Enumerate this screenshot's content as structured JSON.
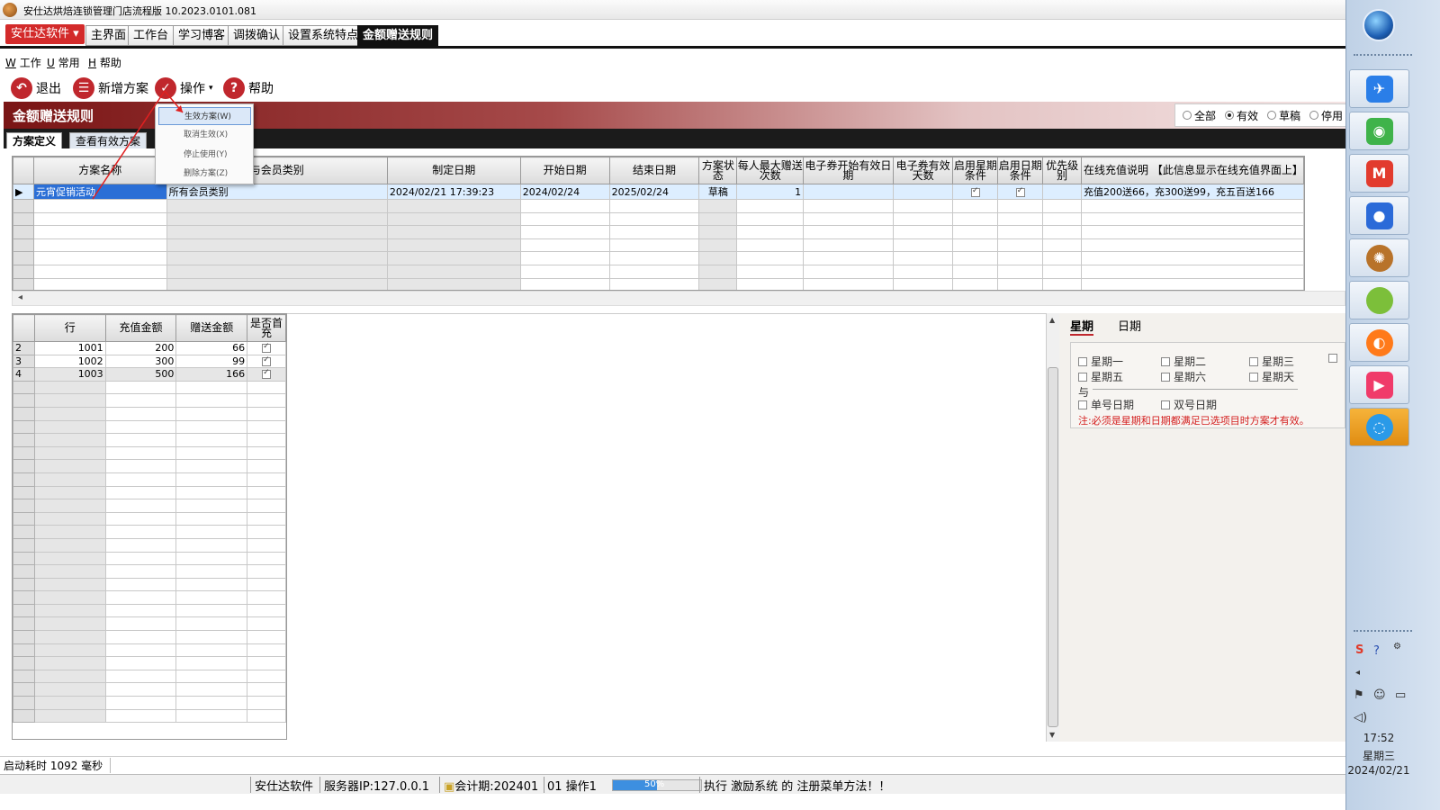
{
  "window": {
    "title": "安仕达烘焙连锁管理门店流程版   10.2023.0101.081"
  },
  "brand_button": "安仕达软件",
  "main_tabs": [
    "主界面",
    "工作台",
    "学习博客",
    "调拨确认",
    "设置系统特点",
    "金额赠送规则"
  ],
  "menubar": {
    "work": "工作",
    "common": "常用",
    "help": "帮助",
    "work_key": "W",
    "common_key": "U",
    "help_key": "H"
  },
  "toolbar": {
    "exit": "退出",
    "new_plan": "新增方案",
    "operate": "操作",
    "help": "帮助"
  },
  "dropdown": {
    "items": [
      "生效方案(W)",
      "取消生效(X)",
      "停止使用(Y)",
      "删除方案(Z)"
    ]
  },
  "banner": {
    "title": "金额赠送规则"
  },
  "filter": {
    "all": "全部",
    "valid": "有效",
    "draft": "草稿",
    "stopped": "停用"
  },
  "sub_tabs": [
    "方案定义",
    "查看有效方案"
  ],
  "plan_grid": {
    "columns": [
      "方案名称",
      "与会员类别",
      "制定日期",
      "开始日期",
      "结束日期",
      "方案状态",
      "每人最大赠送次数",
      "电子券开始有效日期",
      "电子券有效天数",
      "启用星期条件",
      "启用日期条件",
      "优先级别",
      "在线充值说明 【此信息显示在线充值界面上】"
    ],
    "rows": [
      {
        "name": "元宵促销活动",
        "member_type": "所有会员类别",
        "created": "2024/02/21 17:39:23",
        "start": "2024/02/24",
        "end": "2025/02/24",
        "status": "草稿",
        "max_times": "1",
        "coupon_start": "",
        "coupon_days": "",
        "week_cond": true,
        "date_cond": true,
        "priority": "",
        "desc": "充值200送66，充300送99，充五百送166"
      }
    ]
  },
  "detail_grid": {
    "columns": [
      "行",
      "充值金额",
      "赠送金额",
      "是否首充"
    ],
    "rows": [
      {
        "idx": "2",
        "line": "1001",
        "amount": "200",
        "gift": "66",
        "first": true
      },
      {
        "idx": "3",
        "line": "1002",
        "amount": "300",
        "gift": "99",
        "first": true
      },
      {
        "idx": "4",
        "line": "1003",
        "amount": "500",
        "gift": "166",
        "first": true
      }
    ]
  },
  "condition_panel": {
    "tabs": [
      "星期",
      "日期"
    ],
    "weekdays": [
      "星期一",
      "星期二",
      "星期三",
      "星期五",
      "星期六",
      "星期天"
    ],
    "and_label": "与",
    "odd_day": "单号日期",
    "even_day": "双号日期",
    "note": "注:必须是星期和日期都满足已选项目时方案才有效。"
  },
  "status": {
    "startup": "启动耗时 1092 毫秒",
    "company": "安仕达软件",
    "server": "服务器IP:127.0.0.1",
    "period": "会计期:202401",
    "operator": "01 操作1",
    "progress_percent": 50,
    "progress_label": "50%",
    "message": "执行 激励系统 的 注册菜单方法！！"
  },
  "taskbar": {
    "time": "17:52",
    "weekday": "星期三",
    "date": "2024/02/21"
  },
  "colors": {
    "brand_red": "#d32a2a",
    "banner_dark": "#7a1515",
    "selection_blue": "#2b6fd6",
    "note_red": "#d42020"
  }
}
